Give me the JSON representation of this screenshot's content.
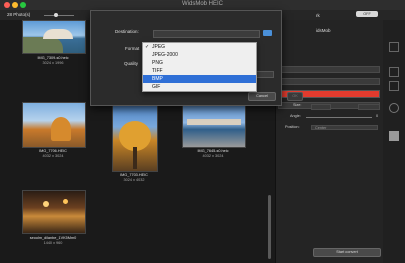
{
  "window": {
    "title": "WidsMob HEIC"
  },
  "toolbar": {
    "photo_count": "28 Photo(s)"
  },
  "thumbnails": [
    {
      "name": "IMG_7309-s0.heic",
      "size": "3024 x 1996"
    },
    {
      "name": "IMG_7706.HEIC",
      "size": "4032 x 3024"
    },
    {
      "name": "IMG_7703.HEIC",
      "size": "3024 x 4032"
    },
    {
      "name": "IMG_7645-s0.heic",
      "size": "4032 x 3024"
    },
    {
      "name": "seoolm_dilanbe_1VK5Mm0",
      "size": "1440 x 960"
    }
  ],
  "dialog": {
    "destination_label": "Destination:",
    "format_label": "Format",
    "quality_label": "Quality",
    "cancel_label": "Cancel",
    "ok_label": "OK"
  },
  "format_menu": {
    "items": [
      "JPEG",
      "JPEG-2000",
      "PNG",
      "TIFF",
      "BMP",
      "GIF"
    ],
    "checked": "JPEG",
    "highlighted": "BMP"
  },
  "right_panel": {
    "watermark_label": "rk",
    "toggle_label": "OFF",
    "watermark_text": "idsMob",
    "size_label": "Size:",
    "angle_label": "Angle:",
    "angle_value": "0",
    "position_label": "Position:",
    "position_value": "Center",
    "start_button": "Start convert"
  },
  "colors": {
    "accent_blue": "#2f6fd6",
    "watermark_red": "#e23b2e"
  }
}
